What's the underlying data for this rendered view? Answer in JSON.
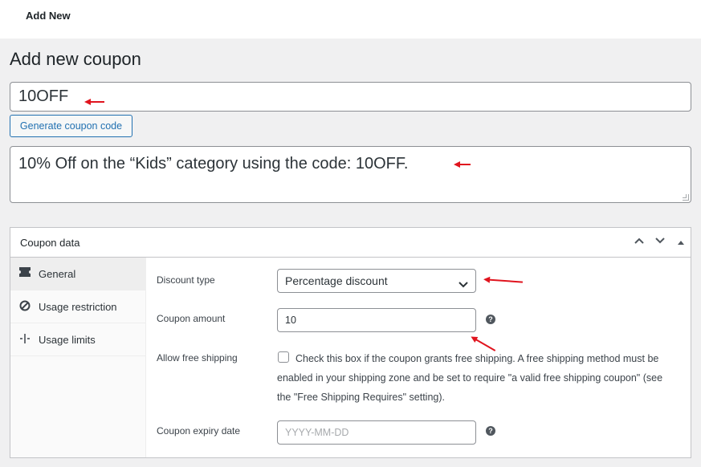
{
  "topbar": {
    "breadcrumb": "Add New"
  },
  "page": {
    "title": "Add new coupon"
  },
  "coupon_code": {
    "value": "10OFF"
  },
  "generate_button": {
    "label": "Generate coupon code"
  },
  "description": {
    "value": "10% Off on the “Kids” category using the code: 10OFF."
  },
  "panel": {
    "title": "Coupon data",
    "tabs": [
      {
        "label": "General",
        "icon": "ticket-icon"
      },
      {
        "label": "Usage restriction",
        "icon": "block-icon"
      },
      {
        "label": "Usage limits",
        "icon": "limits-icon"
      }
    ],
    "fields": {
      "discount_type": {
        "label": "Discount type",
        "value": "Percentage discount"
      },
      "coupon_amount": {
        "label": "Coupon amount",
        "value": "10"
      },
      "free_shipping": {
        "label": "Allow free shipping",
        "text": "Check this box if the coupon grants free shipping. A free shipping method must be enabled in your shipping zone and be set to require \"a valid free shipping coupon\" (see the \"Free Shipping Requires\" setting)."
      },
      "expiry_date": {
        "label": "Coupon expiry date",
        "placeholder": "YYYY-MM-DD"
      }
    }
  },
  "colors": {
    "accent": "#2271b1",
    "annotation_arrow": "#e0141e"
  }
}
